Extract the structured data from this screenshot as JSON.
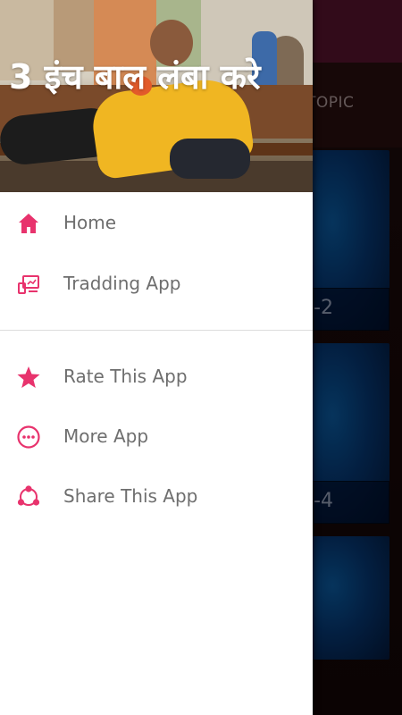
{
  "background_app": {
    "tab_label": "TOPIC",
    "cards": [
      {
        "caption": "-2"
      },
      {
        "caption": "-4"
      },
      {
        "caption": ""
      }
    ]
  },
  "drawer": {
    "header_title": "3 इंच बाल लंबा करे",
    "primary_items": [
      {
        "label": "Home",
        "icon": "home-icon"
      },
      {
        "label": "Tradding App",
        "icon": "devices-icon"
      }
    ],
    "secondary_items": [
      {
        "label": "Rate This App",
        "icon": "star-icon"
      },
      {
        "label": "More App",
        "icon": "more-dots-icon"
      },
      {
        "label": "Share This App",
        "icon": "share-icon"
      }
    ]
  },
  "colors": {
    "accent": "#e8336d",
    "toolbar": "#5c1530",
    "label_text": "#6e6e6e"
  }
}
